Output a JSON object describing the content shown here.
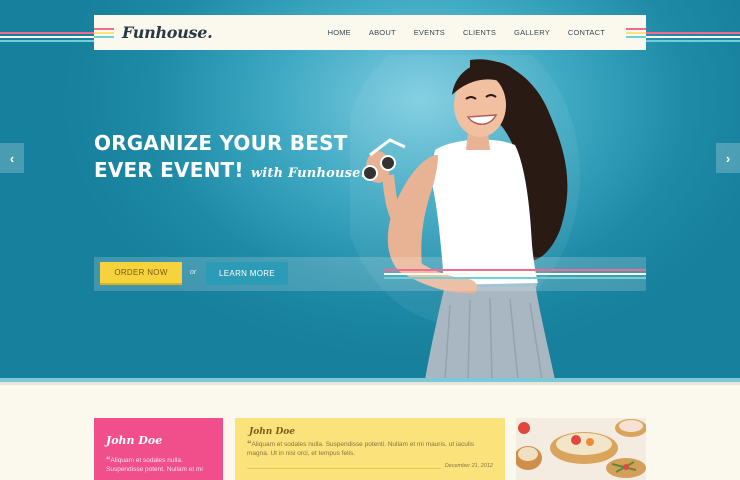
{
  "brand": {
    "logo": "Funhouse."
  },
  "nav": [
    "HOME",
    "ABOUT",
    "EVENTS",
    "CLIENTS",
    "GALLERY",
    "CONTACT"
  ],
  "hero": {
    "headline_line1": "ORGANIZE YOUR BEST",
    "headline_line2": "EVER EVENT!",
    "headline_script": "with Funhouse.",
    "order_label": "ORDER NOW",
    "or_label": "or",
    "learn_label": "LEARN MORE",
    "prev_arrow": "‹",
    "next_arrow": "›"
  },
  "testimonials": [
    {
      "name": "John Doe",
      "quote": "Aliquam et sodales nulla. Suspendisse potent. Nullam et mi"
    },
    {
      "name": "John Doe",
      "quote": "Aliquam et sodales nulla. Suspendisse potenti. Nullam et mi mauris, ut iaculis magna. Ut in nisi orci, et tempus felis.",
      "date": "December 21, 2012"
    }
  ],
  "colors": {
    "stripe_pink": "#f26a8d",
    "stripe_cream": "#fbf9ee",
    "stripe_teal": "#6fd0d6",
    "accent_yellow": "#f6d33c",
    "accent_teal": "#2b9bb6",
    "card_pink": "#f04f8c",
    "card_yellow": "#fbe27a"
  },
  "icons": [
    "chevron-left-icon",
    "chevron-right-icon"
  ]
}
